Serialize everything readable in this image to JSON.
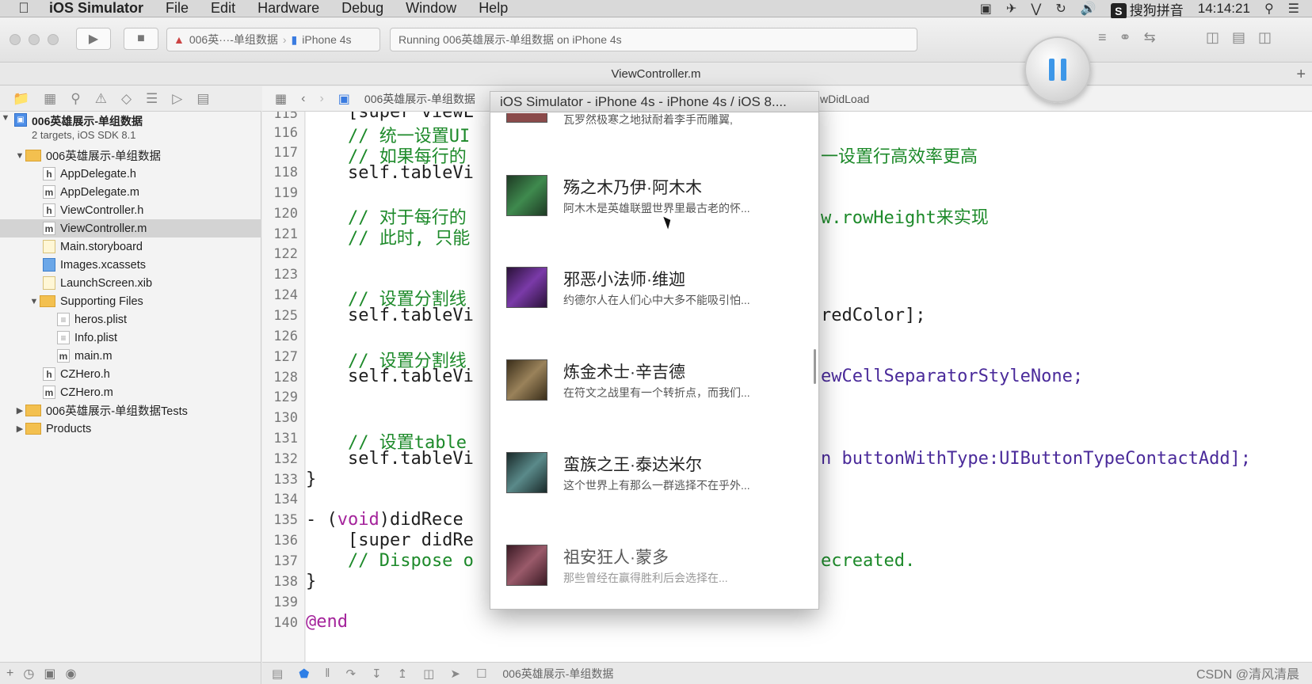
{
  "menubar": {
    "app_name": "iOS Simulator",
    "items": [
      "File",
      "Edit",
      "Hardware",
      "Debug",
      "Window",
      "Help"
    ],
    "input_method": "搜狗拼音",
    "clock": "14:14:21"
  },
  "toolbar": {
    "scheme_name": "006英···-单组数据",
    "device": "iPhone 4s",
    "activity": "Running 006英雄展示-单组数据 on iPhone 4s"
  },
  "editor_title": "ViewController.m",
  "navigator": {
    "project_name": "006英雄展示-单组数据",
    "project_sub": "2 targets, iOS SDK 8.1",
    "items": [
      {
        "label": "006英雄展示-单组数据",
        "kind": "folder"
      },
      {
        "label": "AppDelegate.h",
        "kind": "h"
      },
      {
        "label": "AppDelegate.m",
        "kind": "m"
      },
      {
        "label": "ViewController.h",
        "kind": "h"
      },
      {
        "label": "ViewController.m",
        "kind": "m"
      },
      {
        "label": "Main.storyboard",
        "kind": "storyboard"
      },
      {
        "label": "Images.xcassets",
        "kind": "assets"
      },
      {
        "label": "LaunchScreen.xib",
        "kind": "xib"
      },
      {
        "label": "Supporting Files",
        "kind": "folder"
      },
      {
        "label": "heros.plist",
        "kind": "plist"
      },
      {
        "label": "Info.plist",
        "kind": "plist"
      },
      {
        "label": "main.m",
        "kind": "m"
      },
      {
        "label": "CZHero.h",
        "kind": "h"
      },
      {
        "label": "CZHero.m",
        "kind": "m"
      },
      {
        "label": "006英雄展示-单组数据Tests",
        "kind": "folder"
      },
      {
        "label": "Products",
        "kind": "folder"
      }
    ]
  },
  "jumpbar": {
    "crumb": "006英雄展示-单组数据",
    "method": "wDidLoad"
  },
  "code": {
    "line_numbers": [
      "115",
      "116",
      "117",
      "118",
      "119",
      "120",
      "121",
      "122",
      "123",
      "124",
      "125",
      "126",
      "127",
      "128",
      "129",
      "130",
      "131",
      "132",
      "133",
      "134",
      "135",
      "136",
      "137",
      "138",
      "139",
      "140"
    ],
    "l115": "    [super viewL",
    "l116": "    // 统一设置UI",
    "l117a": "    // 如果每行的",
    "l117b": "一设置行高效率更高",
    "l118": "    self.tableVi",
    "l120a": "    // 对于每行的",
    "l120b": "w.rowHeight来实现",
    "l121": "    // 此时, 只能",
    "l124": "    // 设置分割线",
    "l125a": "    self.tableVi",
    "l125b": "redColor];",
    "l127": "    // 设置分割线",
    "l128a": "    self.tableVi",
    "l128b": "ewCellSeparatorStyleNone;",
    "l131": "    // 设置table",
    "l132a": "    self.tableVi",
    "l132b": "n buttonWithType:UIButtonTypeContactAdd];",
    "l133": "}",
    "l135_prefix": "- (",
    "l135_kw": "void",
    "l135_rest": ")didRece",
    "l136": "    [super didRe",
    "l137a": "    // Dispose o",
    "l137b": "ecreated.",
    "l138": "}",
    "l140": "@end"
  },
  "simulator": {
    "title": "iOS Simulator - iPhone 4s - iPhone 4s / iOS 8....",
    "partial_top_text": "瓦罗然极寒之地狱耐着李手而雕翼,",
    "heroes": [
      {
        "name": "殇之木乃伊·阿木木",
        "intro": "阿木木是英雄联盟世界里最古老的怀...",
        "color": "#2f6b3a"
      },
      {
        "name": "邪恶小法师·维迦",
        "intro": "约德尔人在人们心中大多不能吸引怕...",
        "color": "#5b2d7a"
      },
      {
        "name": "炼金术士·辛吉德",
        "intro": "在符文之战里有一个转折点，而我们...",
        "color": "#6a5a3a"
      },
      {
        "name": "蛮族之王·泰达米尔",
        "intro": "这个世界上有那么一群逃择不在乎外...",
        "color": "#3e5a5a"
      },
      {
        "name": "祖安狂人·蒙多",
        "intro": "那些曾经在赢得胜利后会选择在...",
        "color": "#6a3a4a"
      }
    ]
  },
  "debugbar": {
    "target_label": "006英雄展示-单组数据"
  },
  "watermark": "CSDN @清风清晨"
}
